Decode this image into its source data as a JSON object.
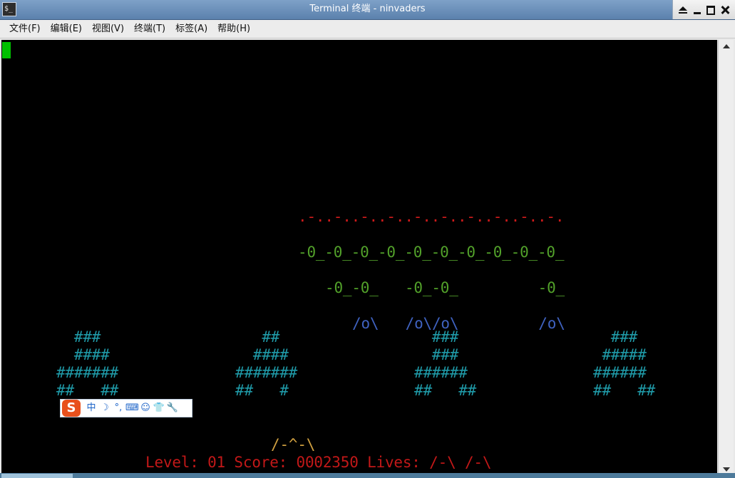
{
  "window": {
    "title": "Terminal 终端 - ninvaders"
  },
  "menu": {
    "items": [
      "文件(F)",
      "编辑(E)",
      "视图(V)",
      "终端(T)",
      "标签(A)",
      "帮助(H)"
    ]
  },
  "game": {
    "aliens_row1": ".-..-..-..-..-..-..-..-..-..-.",
    "aliens_row2": "-0_-0_-0_-0_-0_-0_-0_-0_-0_-0_",
    "aliens_row3": "-0_-0_   -0_-0_         -0_",
    "aliens_row4": "/o\\   /o\\/o\\         /o\\",
    "bunker1": [
      "  ###",
      "  ####",
      "#######",
      "##   ##"
    ],
    "bunker2": [
      "   ##",
      "  ####",
      "#######",
      "##   #"
    ],
    "bunker3": [
      "  ###",
      "  ###",
      "######",
      "##   ##"
    ],
    "bunker4": [
      "  ###",
      " #####",
      "######",
      "##   ##"
    ],
    "player": "/-^-\\",
    "status_line": "Level: 01 Score: 0002350 Lives: /-\\ /-\\"
  },
  "ime": {
    "logo": "S",
    "mode": "中",
    "moon_icon": "☽",
    "punct": "°,",
    "keyboard_icon": "⌨",
    "user_icon": "☺",
    "shirt_icon": "👕",
    "wrench_icon": "🔧"
  }
}
